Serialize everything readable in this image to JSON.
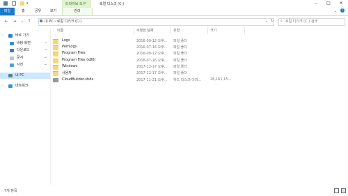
{
  "window": {
    "title": "로컬 디스크 (C:)",
    "context_tab": "드라이브 도구"
  },
  "ribbon": {
    "tabs": [
      "파일",
      "홈",
      "공유",
      "보기"
    ],
    "manage": "관리"
  },
  "nav": {
    "back": "←",
    "forward": "→",
    "dropdown": "⌄",
    "up": "↑"
  },
  "address": {
    "crumbs": "내 PC  ›  로컬 디스크 (C:)",
    "search_placeholder": "로컬 디스크 (C:) 검색"
  },
  "sidebar": {
    "items": [
      {
        "label": "바로 가기",
        "pin": false
      },
      {
        "label": "바탕 화면",
        "pin": true
      },
      {
        "label": "다운로드",
        "pin": true
      },
      {
        "label": "문서",
        "pin": true
      },
      {
        "label": "사진",
        "pin": true
      },
      {
        "label": "내 PC",
        "pin": false
      },
      {
        "label": "네트워크",
        "pin": false
      }
    ]
  },
  "columns": {
    "name": "이름",
    "date": "수정한 날짜",
    "type": "유형",
    "size": "크기"
  },
  "files": [
    {
      "name": "Logs",
      "date": "2016-09-12 오후...",
      "type": "파일 폴더",
      "size": "",
      "kind": "folder"
    },
    {
      "name": "PerfLogs",
      "date": "2016-07-16 오후...",
      "type": "파일 폴더",
      "size": "",
      "kind": "folder"
    },
    {
      "name": "Program Files",
      "date": "2016-09-12 오후...",
      "type": "파일 폴더",
      "size": "",
      "kind": "folder"
    },
    {
      "name": "Program Files (x86)",
      "date": "2016-07-16 오후...",
      "type": "파일 폴더",
      "size": "",
      "kind": "folder"
    },
    {
      "name": "Windows",
      "date": "2017-12-17 오후...",
      "type": "파일 폴더",
      "size": "",
      "kind": "folder"
    },
    {
      "name": "사용자",
      "date": "2017-12-17 오후...",
      "type": "파일 폴더",
      "size": "",
      "kind": "folder"
    },
    {
      "name": "CloudBuilder.vhdx",
      "date": "2017-11-21 오후...",
      "type": "하드 디스크 이미...",
      "size": "26,161,15...",
      "kind": "vhdx"
    }
  ],
  "status": {
    "count": "7개 항목"
  },
  "colors": {
    "accent": "#1979ca",
    "context": "#dff3d0",
    "selected": "#cce8ff",
    "folder": "#f8d775"
  }
}
